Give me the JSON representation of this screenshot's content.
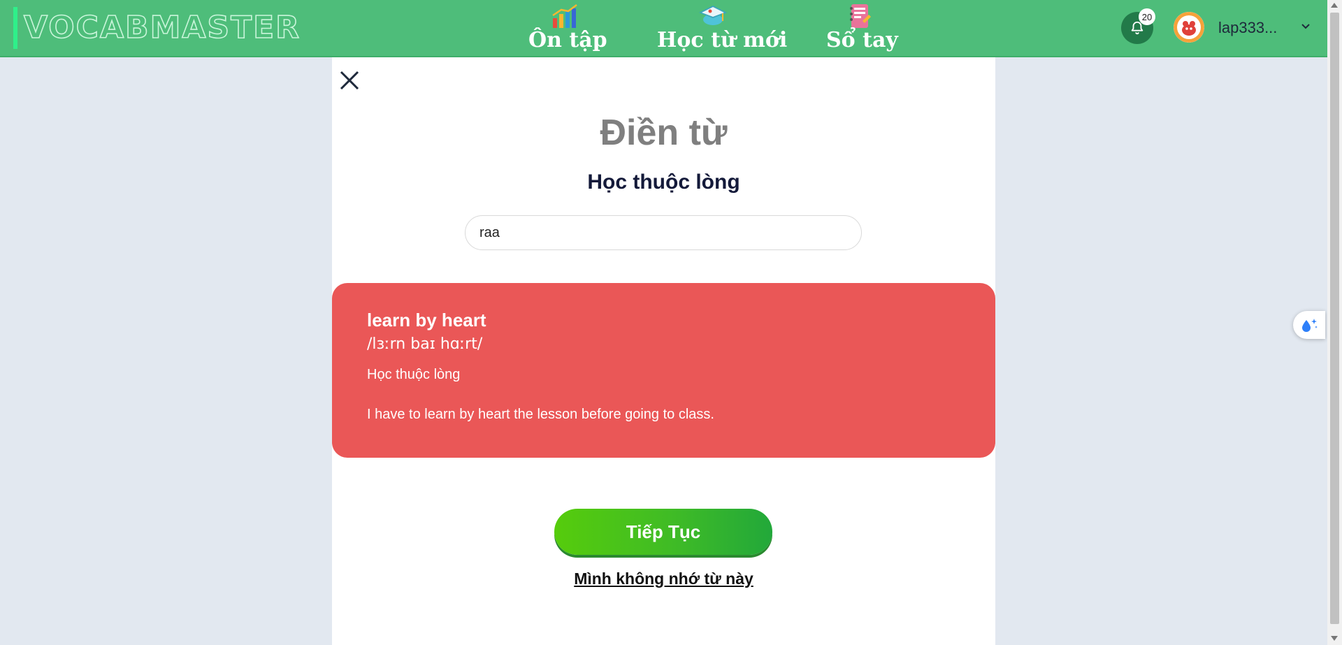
{
  "header": {
    "brand": "VOCABMASTER",
    "nav": [
      {
        "label": "Ôn tập",
        "icon": "bar-chart-icon"
      },
      {
        "label": "Học từ mới",
        "icon": "graduation-cap-icon"
      },
      {
        "label": "Sổ tay",
        "icon": "notebook-icon"
      }
    ],
    "notification_count": "20",
    "username": "lap333..."
  },
  "exercise": {
    "title": "Điền từ",
    "prompt": "Học thuộc lòng",
    "answer_value": "raa"
  },
  "result": {
    "word": "learn by heart",
    "phonetic": "/lɜːrn baɪ hɑːrt/",
    "meaning": "Học thuộc lòng",
    "example": "I have to learn by heart the lesson before going to class.",
    "color": "#ea5757"
  },
  "actions": {
    "continue_label": "Tiếp Tục",
    "forgot_label": "Mình không nhớ từ này"
  },
  "colors": {
    "header": "#4ebd7a",
    "background": "#e2e8f0"
  }
}
